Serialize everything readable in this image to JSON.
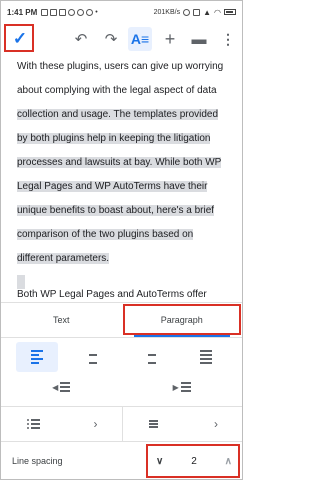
{
  "status_bar": {
    "time": "1:41 PM",
    "speed": "201KB/s",
    "left_icons": [
      "sim-icon",
      "message-icon",
      "gallery-icon",
      "gear-icon",
      "instagram-icon",
      "facebook-icon",
      "more-dot-icon"
    ],
    "right_icons": [
      "alarm-icon",
      "volte-icon",
      "signal-icon",
      "wifi-icon",
      "battery-icon"
    ]
  },
  "toolbar": {
    "done_icon": "check-icon",
    "undo_icon": "undo-icon",
    "redo_icon": "redo-icon",
    "format_icon": "text-format-icon",
    "insert_icon": "plus-icon",
    "comment_icon": "comment-icon",
    "more_icon": "more-vert-icon",
    "accent_color": "#1a73e8",
    "highlight_color": "#d93025"
  },
  "document": {
    "paragraph1_plain": "With these plugins, users can give up worrying about complying with the legal aspect of data",
    "paragraph1_highlighted": "collection and usage. The templates provided by both plugins help in keeping the litigation processes and lawsuits at bay. While both WP Legal Pages and WP AutoTerms have their unique benefits to boast about, here's a brief comparison of the two plugins based on different parameters.",
    "paragraph2": "Both WP Legal Pages and AutoTerms offer"
  },
  "tabs": {
    "text_label": "Text",
    "paragraph_label": "Paragraph",
    "active": "Paragraph"
  },
  "alignment": {
    "options": [
      "align-left-icon",
      "align-center-icon",
      "align-right-icon",
      "align-justify-icon"
    ],
    "selected": "align-left-icon"
  },
  "indent": {
    "decrease_icon": "indent-decrease-icon",
    "increase_icon": "indent-increase-icon"
  },
  "lists": {
    "bulleted_icon": "bulleted-list-icon",
    "numbered_icon": "numbered-list-icon",
    "expand_icon": "chevron-right-icon"
  },
  "line_spacing": {
    "label": "Line spacing",
    "value": "2",
    "decrease_icon": "chevron-down-icon",
    "increase_icon": "chevron-up-icon"
  }
}
